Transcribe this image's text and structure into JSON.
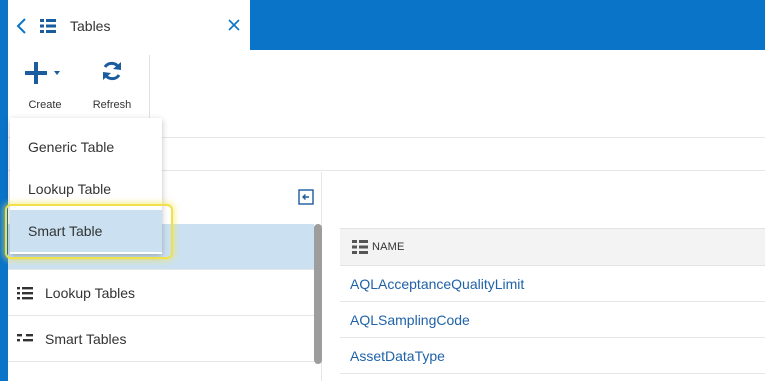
{
  "tab": {
    "title": "Tables"
  },
  "toolbar": {
    "create_label": "Create",
    "refresh_label": "Refresh"
  },
  "create_menu": {
    "items": [
      {
        "label": "Generic Table"
      },
      {
        "label": "Lookup Table"
      },
      {
        "label": "Smart Table"
      }
    ]
  },
  "nav": {
    "items": [
      {
        "label": ""
      },
      {
        "label": "Lookup Tables"
      },
      {
        "label": "Smart Tables"
      }
    ]
  },
  "grid": {
    "column_header": "NAME",
    "rows": [
      {
        "name": "AQLAcceptanceQualityLimit"
      },
      {
        "name": "AQLSamplingCode"
      },
      {
        "name": "AssetDataType"
      }
    ]
  },
  "colors": {
    "brand_blue": "#0a74c9",
    "selection": "#cbe1f1",
    "link": "#1f62a8",
    "highlight": "#f0e14a"
  },
  "icons": {
    "back": "chevron-left-icon",
    "tab": "grid-icon",
    "close": "close-icon",
    "create": "plus-icon",
    "refresh": "refresh-icon",
    "collapse": "collapse-panel-icon",
    "lookup": "list-icon",
    "smart": "smart-table-icon"
  }
}
